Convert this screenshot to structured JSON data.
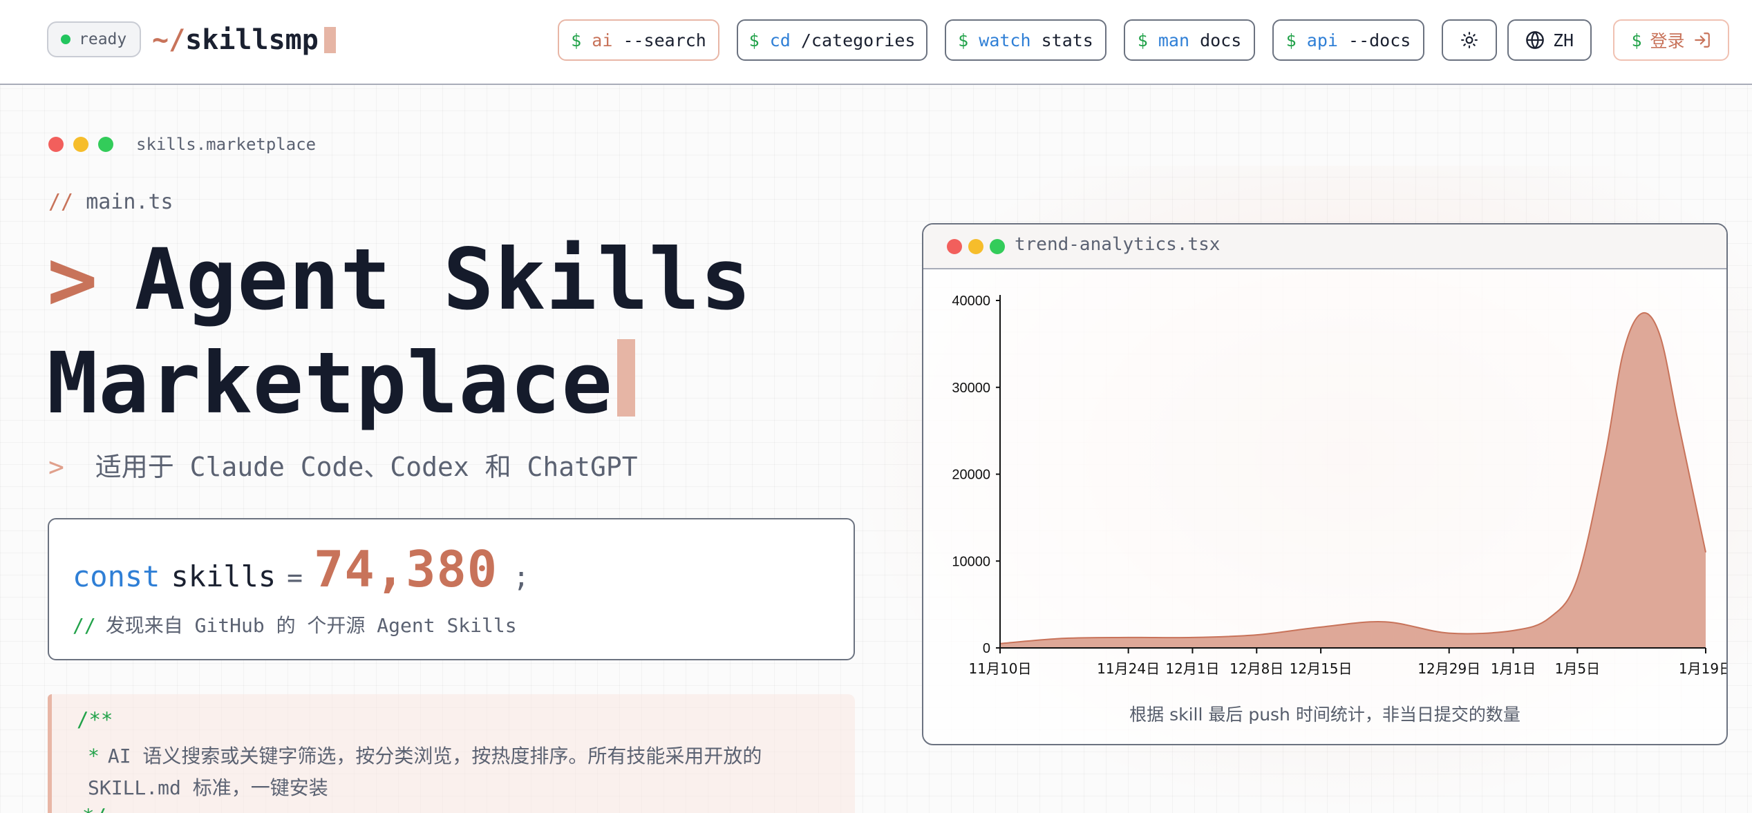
{
  "header": {
    "status_label": "ready",
    "logo_prefix": "~/",
    "logo_name": "skillsmp",
    "nav": [
      {
        "dollar": "$",
        "command": "ai",
        "arg": "--search"
      },
      {
        "dollar": "$",
        "command": "cd",
        "arg": "/categories"
      },
      {
        "dollar": "$",
        "command": "watch",
        "arg": "stats"
      },
      {
        "dollar": "$",
        "command": "man",
        "arg": "docs"
      },
      {
        "dollar": "$",
        "command": "api",
        "arg": "--docs"
      }
    ],
    "theme_icon": "sun-icon",
    "lang_icon": "globe-icon",
    "lang_label": "ZH",
    "login_dollar": "$",
    "login_label": "登录",
    "login_icon": "sign-in-icon"
  },
  "main": {
    "window_title": "skills.marketplace",
    "file_comment_prefix": "//",
    "file_comment": "main.ts",
    "hero_prompt": ">",
    "hero_line1": "Agent Skills",
    "hero_line2": "Marketplace",
    "subtitle_prompt": ">",
    "subtitle": "适用于 Claude Code、Codex 和 ChatGPT",
    "counter": {
      "keyword": "const",
      "variable": "skills",
      "equals": "=",
      "value": "74,380",
      "semicolon": ";",
      "comment_prefix": "//",
      "comment": "发现来自 GitHub 的 个开源 Agent Skills"
    },
    "doc": {
      "open": "/**",
      "star": "*",
      "line1": "AI 语义搜索或关键字筛选，按分类浏览，按热度排序。所有技能采用开放的",
      "line2": "SKILL.md 标准，一键安装",
      "close": "*/"
    }
  },
  "chart": {
    "window_title": "trend-analytics.tsx",
    "caption": "根据 skill 最后 push 时间统计，非当日提交的数量"
  },
  "chart_data": {
    "type": "area",
    "title": "",
    "xlabel": "",
    "ylabel": "",
    "ylim": [
      0,
      40000
    ],
    "yticks": [
      0,
      10000,
      20000,
      30000,
      40000
    ],
    "ytick_labels": [
      "0",
      "10000",
      "20000",
      "30000",
      "40000"
    ],
    "xticks": [
      "11月10日",
      "11月24日",
      "12月1日",
      "12月8日",
      "12月15日",
      "12月29日",
      "1月1日",
      "1月5日",
      "1月19日"
    ],
    "x_range_days": [
      0,
      70
    ],
    "xtick_days": [
      0,
      14,
      21,
      28,
      35,
      49,
      56,
      63,
      77
    ],
    "color": "#c8735a",
    "fill": "#dea898",
    "series": [
      {
        "name": "",
        "x_days": [
          0,
          7,
          14,
          21,
          28,
          35,
          42,
          49,
          56,
          60,
          63,
          66,
          68,
          70,
          72,
          74,
          77
        ],
        "values": [
          500,
          1100,
          1200,
          1200,
          1500,
          2400,
          3000,
          1700,
          2000,
          3500,
          8000,
          22000,
          34000,
          38500,
          36000,
          26000,
          11000
        ]
      }
    ],
    "grid": false,
    "legend": "none"
  },
  "colors": {
    "accent": "#c8735a",
    "keyword_blue": "#2f7fd6",
    "comment_green": "#22a24a",
    "traffic_red": "#f25f5c",
    "traffic_yellow": "#f6bd2b",
    "traffic_green": "#33cc5a"
  }
}
